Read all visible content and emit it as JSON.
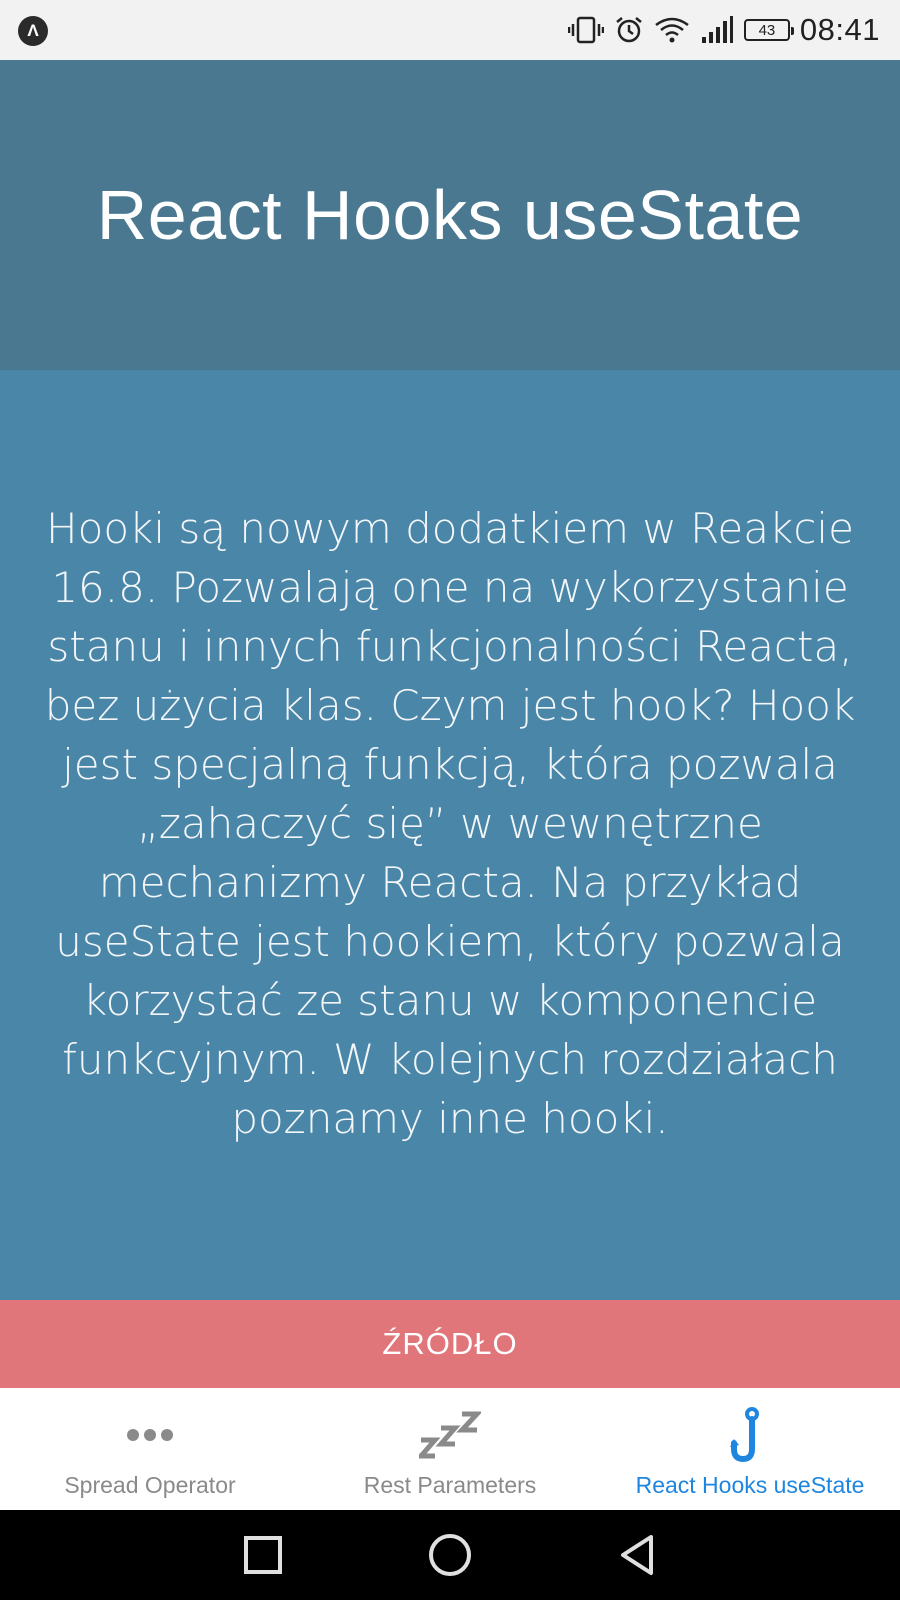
{
  "status_bar": {
    "app_icon": "Λ",
    "battery": "43",
    "time": "08:41",
    "icons": [
      "vibrate-icon",
      "alarm-icon",
      "wifi-icon",
      "signal-icon",
      "battery-icon"
    ]
  },
  "header": {
    "title": "React Hooks useState"
  },
  "content": {
    "text": "Hooki są nowym dodatkiem w Reakcie 16.8. Pozwalają one na wykorzystanie stanu i innych funkcjonalności Reacta, bez użycia klas. Czym jest hook? Hook jest specjalną funkcją, która pozwala „zahaczyć się” w wewnętrzne mechanizmy Reacta. Na przykład useState jest hookiem, który pozwala korzystać ze stanu w komponencie funkcyjnym. W kolejnych rozdziałach poznamy inne hooki."
  },
  "source_button": {
    "label": "ŹRÓDŁO"
  },
  "tabs": [
    {
      "label": "Spread Operator",
      "icon": "more-dots-icon",
      "active": false
    },
    {
      "label": "Rest Parameters",
      "icon": "sleep-zzz-icon",
      "active": false
    },
    {
      "label": "React Hooks useState",
      "icon": "hook-icon",
      "active": true
    }
  ],
  "colors": {
    "header_bg": "#4a7891",
    "content_bg": "#4a86a8",
    "button_bg": "#e0757a",
    "active_tab": "#1f86e0",
    "inactive_tab": "#8a8a8a"
  }
}
